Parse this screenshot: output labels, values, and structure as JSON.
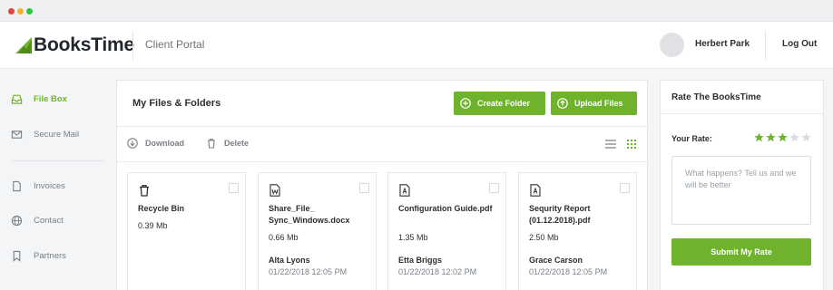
{
  "window": {
    "dots": [
      "#e0443e",
      "#f5b32b",
      "#2ac940"
    ]
  },
  "header": {
    "logo_text": "BooksTime",
    "portal_label": "Client Portal",
    "user_name": "Herbert Park",
    "logout_label": "Log Out"
  },
  "colors": {
    "accent": "#6fb32c",
    "star_empty": "#d9dcdf"
  },
  "sidebar": {
    "items": [
      {
        "label": "File Box",
        "icon": "inbox-icon",
        "active": true
      },
      {
        "label": "Secure Mail",
        "icon": "mail-icon",
        "active": false
      },
      {
        "label": "Invoices",
        "icon": "document-icon",
        "active": false
      },
      {
        "label": "Contact",
        "icon": "globe-icon",
        "active": false
      },
      {
        "label": "Partners",
        "icon": "bookmark-icon",
        "active": false
      }
    ]
  },
  "main": {
    "title": "My Files & Folders",
    "create_folder_label": "Create Folder",
    "upload_files_label": "Upload Files",
    "download_label": "Download",
    "delete_label": "Delete",
    "view_mode": "grid"
  },
  "files": [
    {
      "name": "Recycle Bin",
      "size": "0.39 Mb",
      "owner": "",
      "date": "",
      "icon": "trash-icon"
    },
    {
      "name": "Share_File_ Sync_Windows.docx",
      "size": "0.66 Mb",
      "owner": "Alta Lyons",
      "date": "01/22/2018 12:05 PM",
      "icon": "word-file-icon"
    },
    {
      "name": "Configuration Guide.pdf",
      "size": "1.35 Mb",
      "owner": "Etta Briggs",
      "date": "01/22/2018 12:02 PM",
      "icon": "pdf-file-icon"
    },
    {
      "name": "Sequrity Report (01.12.2018).pdf",
      "size": "2.50 Mb",
      "owner": "Grace Carson",
      "date": "01/22/2018 12:05 PM",
      "icon": "pdf-file-icon"
    }
  ],
  "rating": {
    "title": "Rate The BooksTime",
    "label": "Your Rate:",
    "stars_filled": 3,
    "stars_total": 5,
    "feedback_placeholder": "What happens? Tell us and we will be better",
    "submit_label": "Submit My Rate"
  }
}
